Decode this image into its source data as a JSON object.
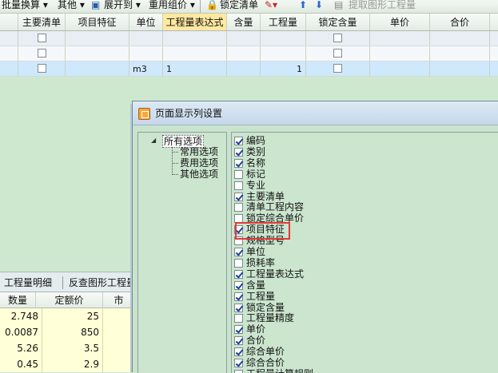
{
  "toolbar": {
    "items": [
      "批量换算 ▾",
      "其他 ▾",
      "展开到 ▾",
      "重用组价 ▾",
      "锁定清单",
      "提取图形工程量"
    ]
  },
  "grid": {
    "headers": [
      "主要清单",
      "项目特征",
      "单位",
      "工程量表达式",
      "含量",
      "工程量",
      "锁定含量",
      "单价",
      "合价"
    ],
    "selected_row": {
      "unit": "m3",
      "expression": "1",
      "quantity": "1"
    }
  },
  "bottom": {
    "tabs": [
      "工程量明细",
      "反查图形工程量"
    ],
    "headers": [
      "数量",
      "定额价",
      "市"
    ],
    "rows": [
      {
        "qty": "2.748",
        "price": "25"
      },
      {
        "qty": "0.0087",
        "price": "850"
      },
      {
        "qty": "5.26",
        "price": "3.5"
      },
      {
        "qty": "0.45",
        "price": "2.9"
      }
    ]
  },
  "dialog": {
    "title": "页面显示列设置",
    "tree": {
      "root": "所有选项",
      "children": [
        "常用选项",
        "费用选项",
        "其他选项"
      ]
    },
    "options": [
      {
        "label": "编码",
        "checked": true
      },
      {
        "label": "类别",
        "checked": true
      },
      {
        "label": "名称",
        "checked": true
      },
      {
        "label": "标记",
        "checked": false
      },
      {
        "label": "专业",
        "checked": false
      },
      {
        "label": "主要清单",
        "checked": true
      },
      {
        "label": "清单工程内容",
        "checked": false
      },
      {
        "label": "锁定综合单价",
        "checked": false
      },
      {
        "label": "项目特征",
        "checked": true
      },
      {
        "label": "规格型号",
        "checked": false
      },
      {
        "label": "单位",
        "checked": true
      },
      {
        "label": "损耗率",
        "checked": false
      },
      {
        "label": "工程量表达式",
        "checked": true
      },
      {
        "label": "含量",
        "checked": true
      },
      {
        "label": "工程量",
        "checked": true
      },
      {
        "label": "锁定含量",
        "checked": true
      },
      {
        "label": "工程量精度",
        "checked": false
      },
      {
        "label": "单价",
        "checked": true
      },
      {
        "label": "合价",
        "checked": true
      },
      {
        "label": "综合单价",
        "checked": true
      },
      {
        "label": "综合合价",
        "checked": true
      },
      {
        "label": "工程量计算规则",
        "checked": false
      }
    ]
  },
  "colors": {
    "highlight_header": "#ffe8a0",
    "selected_row": "#cfe8fb",
    "red_box": "#e43a3a"
  }
}
